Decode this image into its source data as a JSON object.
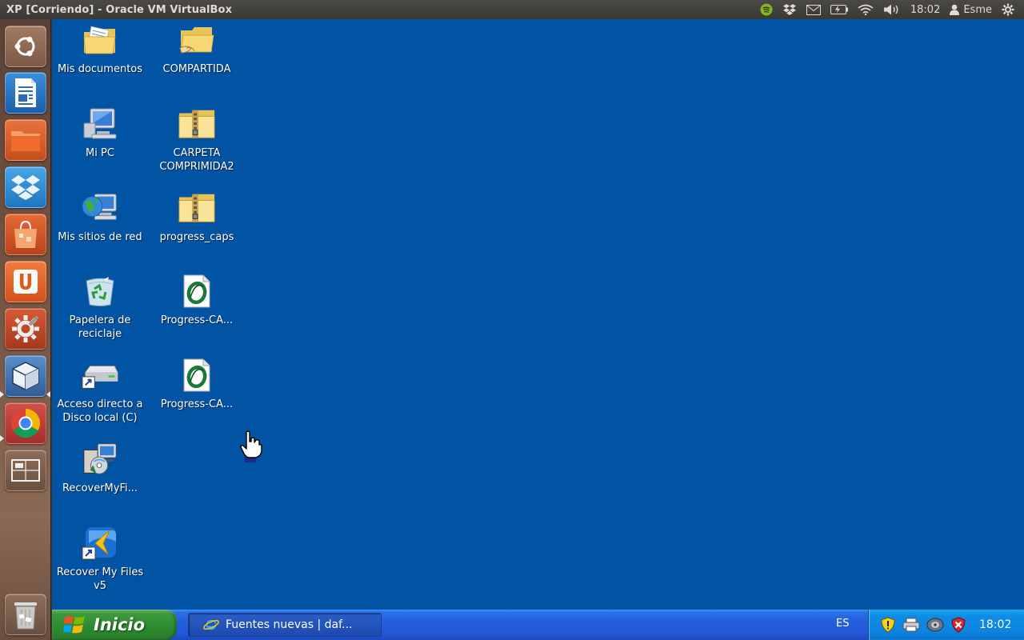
{
  "window_title": "XP [Corriendo] - Oracle VM VirtualBox",
  "panel": {
    "time": "18:02",
    "user": "Esme",
    "indicators": [
      "spotify-icon",
      "dropbox-icon",
      "mail-icon",
      "battery-icon",
      "wifi-icon",
      "volume-icon",
      "gear-icon"
    ]
  },
  "launcher": {
    "items": [
      {
        "name": "ubuntu-dash"
      },
      {
        "name": "libreoffice-writer"
      },
      {
        "name": "files"
      },
      {
        "name": "dropbox"
      },
      {
        "name": "software-center"
      },
      {
        "name": "ubuntu-one"
      },
      {
        "name": "system-settings"
      },
      {
        "name": "virtualbox"
      },
      {
        "name": "chrome"
      },
      {
        "name": "workspace-switcher"
      },
      {
        "name": "trash"
      }
    ]
  },
  "desktop": {
    "icons": [
      {
        "label": "Mis documentos",
        "icon": "folder-documents-icon"
      },
      {
        "label": "COMPARTIDA",
        "icon": "folder-shared-icon"
      },
      {
        "label": "Mi PC",
        "icon": "computer-icon"
      },
      {
        "label": "CARPETA COMPRIMIDA2",
        "icon": "zip-folder-icon"
      },
      {
        "label": "Mis sitios de red",
        "icon": "network-icon"
      },
      {
        "label": "progress_caps",
        "icon": "zip-folder-icon"
      },
      {
        "label": "Papelera de reciclaje",
        "icon": "recycle-bin-icon"
      },
      {
        "label": "Progress-CA...",
        "icon": "document-o-icon"
      },
      {
        "label": "Acceso directo a Disco local (C)",
        "icon": "drive-shortcut-icon"
      },
      {
        "label": "Progress-CA...",
        "icon": "document-o-icon"
      },
      {
        "label": "RecoverMyFi...",
        "icon": "installer-icon"
      },
      {
        "label": "Recover My Files v5",
        "icon": "recover-app-icon"
      }
    ]
  },
  "taskbar": {
    "start_label": "Inicio",
    "task_label": "Fuentes nuevas | daf...",
    "lang": "ES",
    "clock": "18:02"
  }
}
